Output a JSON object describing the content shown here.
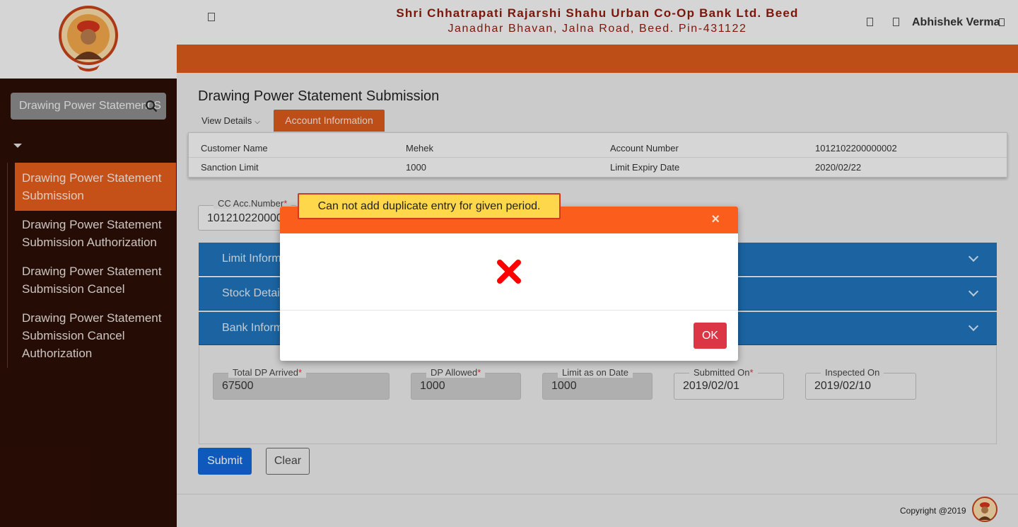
{
  "header": {
    "bank_name": "Shri Chhatrapati Rajarshi Shahu Urban Co-Op Bank Ltd. Beed",
    "bank_address": "Janadhar Bhavan, Jalna Road, Beed. Pin-431122",
    "user_name": "Abhishek Verma"
  },
  "sidebar": {
    "search_value": "Drawing Power Statement S",
    "items": [
      {
        "label": "Drawing Power Statement Submission",
        "active": true
      },
      {
        "label": "Drawing Power Statement Submission Authorization",
        "active": false
      },
      {
        "label": "Drawing Power Statement Submission Cancel",
        "active": false
      },
      {
        "label": "Drawing Power Statement Submission Cancel Authorization",
        "active": false
      }
    ]
  },
  "main": {
    "page_title": "Drawing Power Statement Submission",
    "tabs": {
      "view_details": "View Details",
      "account_information": "Account Information"
    },
    "account_info": {
      "customer_name_label": "Customer Name",
      "customer_name": "Mehek",
      "account_number_label": "Account Number",
      "account_number": "1012102200000002",
      "sanction_limit_label": "Sanction Limit",
      "sanction_limit": "1000",
      "limit_expiry_label": "Limit Expiry Date",
      "limit_expiry": "2020/02/22"
    },
    "cc_account": {
      "label": "CC Acc.Number",
      "required": "*",
      "value": "101210220000"
    },
    "sections": [
      "Limit Inform",
      "Stock Detail",
      "Bank Inform"
    ],
    "bank_fields": [
      {
        "label": "Total DP Arrived",
        "required": "*",
        "value": "67500"
      },
      {
        "label": "DP Allowed",
        "required": "*",
        "value": "1000"
      },
      {
        "label": "Limit as on Date",
        "required": "",
        "value": "1000"
      },
      {
        "label": "Submitted On",
        "required": "*",
        "value": "2019/02/01"
      },
      {
        "label": "Inspected On",
        "required": "",
        "value": "2019/02/10"
      }
    ],
    "submit_label": "Submit",
    "clear_label": "Clear"
  },
  "footer": {
    "copyright": "Copyright @2019"
  },
  "modal": {
    "close_glyph": "×",
    "ok_label": "OK",
    "toast_message": "Can not add duplicate entry for given period."
  },
  "colors": {
    "brand_orange": "#d8591b",
    "modal_header": "#fb5d1c",
    "sidebar_bg": "#2b0e06",
    "accordion_blue": "#1f72b8",
    "primary_button": "#1266d6",
    "danger_button": "#dc3545",
    "error_icon": "#ff0000",
    "toast_bg": "#ffd74a"
  }
}
